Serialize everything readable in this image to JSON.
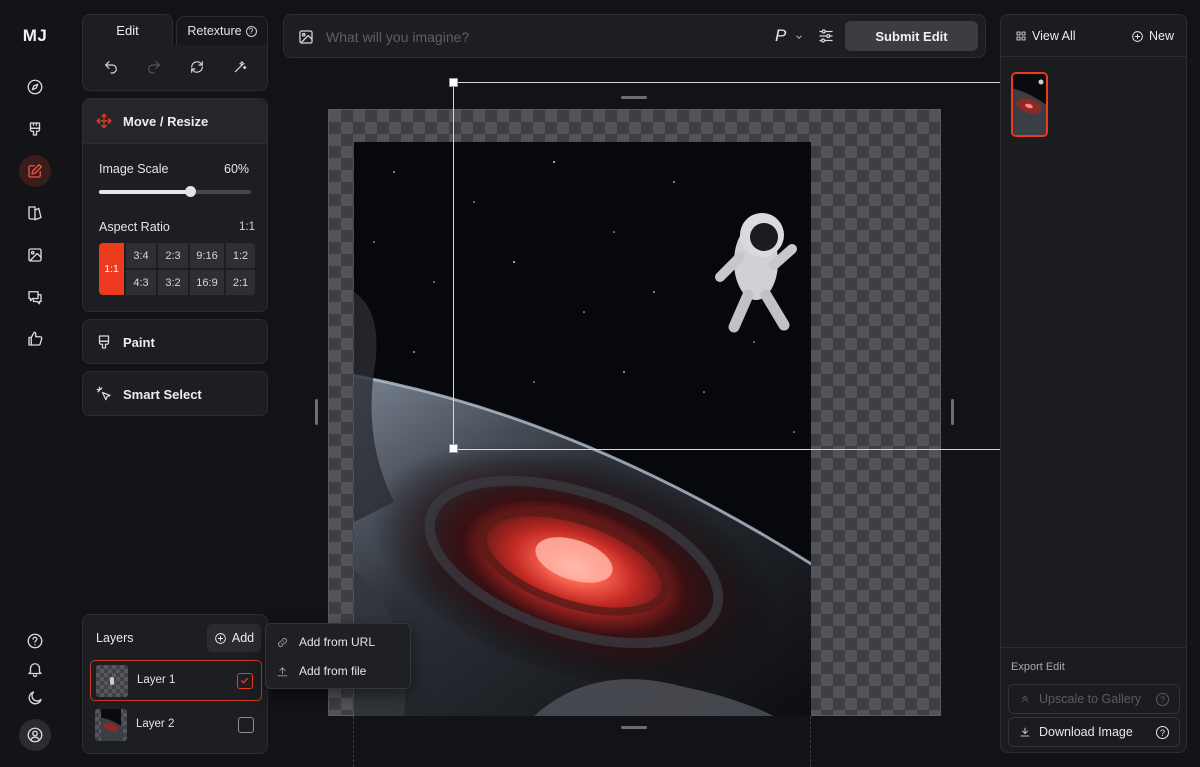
{
  "app": {
    "logo": "MJ"
  },
  "rail": {
    "items": [
      "explore-icon",
      "paint-brush-icon",
      "edit-icon",
      "style-icon",
      "image-icon",
      "chat-icon",
      "thumbs-up-icon"
    ],
    "active": "edit-icon",
    "bottom": [
      "help-icon",
      "bell-icon",
      "moon-icon",
      "account-icon"
    ]
  },
  "tabs": {
    "edit": "Edit",
    "retexture": "Retexture"
  },
  "move_resize": {
    "title": "Move / Resize",
    "image_scale_label": "Image Scale",
    "image_scale_value": "60%",
    "image_scale_fraction": 0.6,
    "aspect_ratio_label": "Aspect Ratio",
    "aspect_ratio_value": "1:1",
    "ratios_active": "1:1",
    "ratios_row1": [
      "3:4",
      "2:3",
      "9:16",
      "1:2"
    ],
    "ratios_row2": [
      "4:3",
      "3:2",
      "16:9",
      "2:1"
    ]
  },
  "paint": {
    "title": "Paint"
  },
  "smart_select": {
    "title": "Smart Select"
  },
  "prompt": {
    "placeholder": "What will you imagine?",
    "mode_glyph": "P",
    "submit_label": "Submit Edit"
  },
  "right_panel": {
    "view_all": "View All",
    "new": "New",
    "export_label": "Export Edit",
    "upscale_label": "Upscale to Gallery",
    "download_label": "Download Image"
  },
  "layers": {
    "title": "Layers",
    "add_label": "Add",
    "items": [
      {
        "name": "Layer 1",
        "checked": true
      },
      {
        "name": "Layer 2",
        "checked": false
      }
    ]
  },
  "add_menu": {
    "from_url": "Add from URL",
    "from_file": "Add from file"
  },
  "colors": {
    "accent": "#ee3a1f",
    "background": "#121316",
    "panel": "#1d1e22"
  }
}
